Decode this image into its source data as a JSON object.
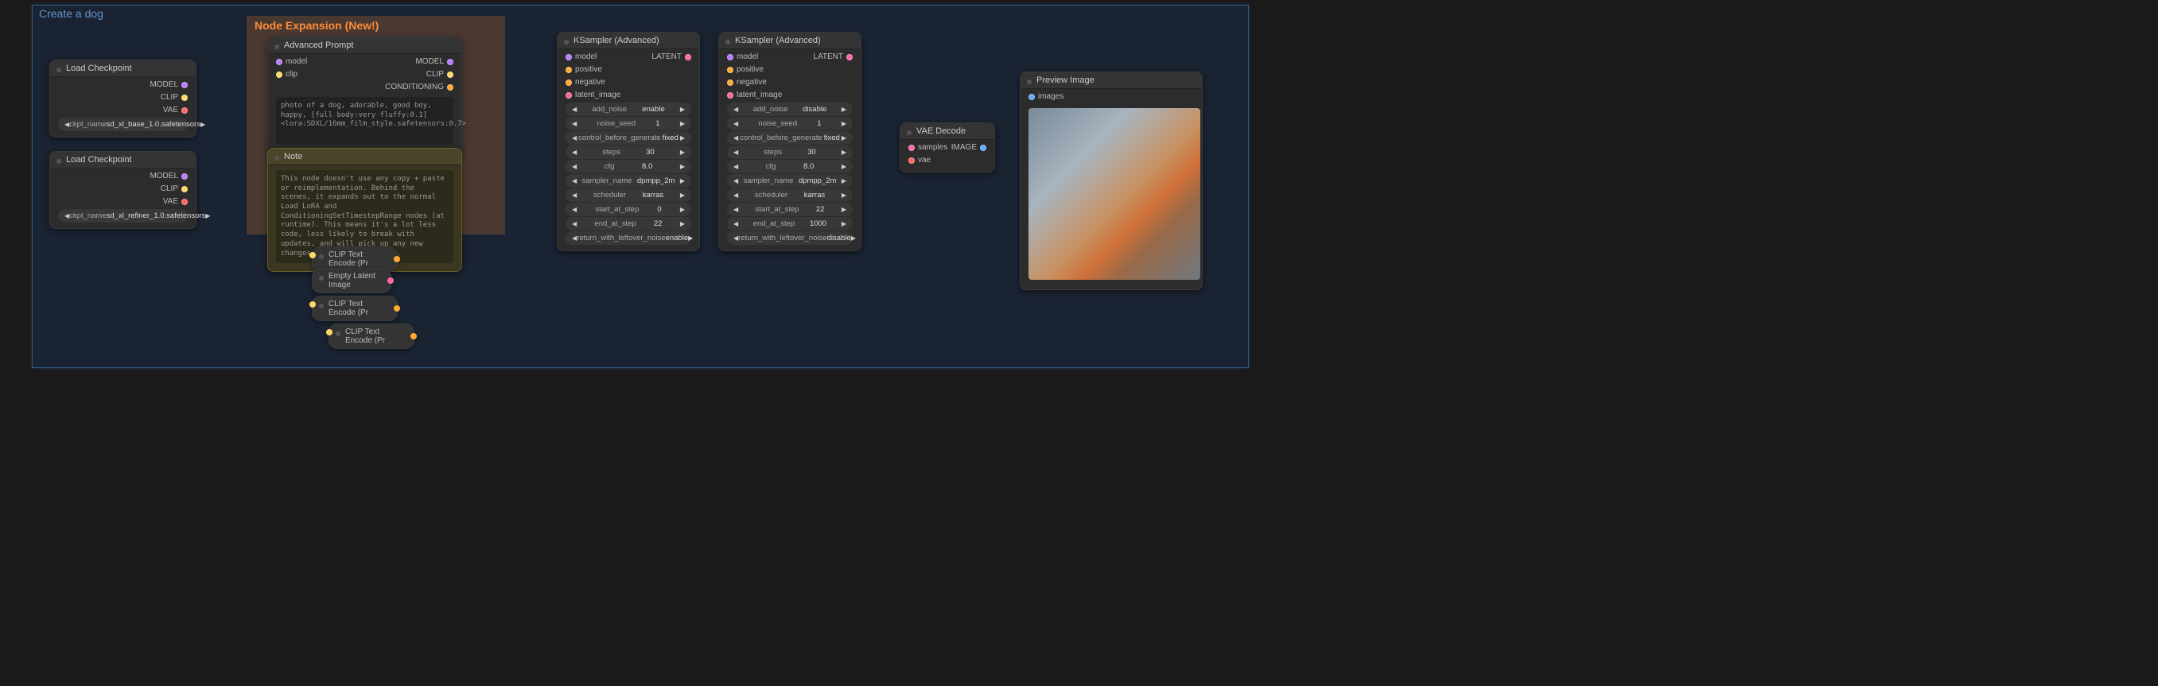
{
  "canvas_title": "Create a dog",
  "group_title": "Node Expansion (New!)",
  "load_ckpt": {
    "title": "Load Checkpoint",
    "widget": "ckpt_name",
    "value": "sd_xl_base_1.0.safetensors",
    "outs": [
      "MODEL",
      "CLIP",
      "VAE"
    ]
  },
  "load_ckpt2": {
    "title": "Load Checkpoint",
    "widget": "ckpt_name",
    "value": "sd_xl_refiner_1.0.safetensors",
    "outs": [
      "MODEL",
      "CLIP",
      "VAE"
    ]
  },
  "adv_prompt": {
    "title": "Advanced Prompt",
    "ins": [
      "model",
      "clip"
    ],
    "outs": [
      "MODEL",
      "CLIP",
      "CONDITIONING"
    ],
    "text": "photo of a dog, adorable, good boy, happy, [full body:very fluffy:0.1] <lora:SDXL/16mm_film_style.safetensors:0.7>"
  },
  "note": {
    "title": "Note",
    "text": "This node doesn't use any copy + paste or reimplementation. Behind the scenes, it expands out to the normal Load LoRA and ConditioningSetTimestepRange nodes (at runtime). This means it's a lot less code, less likely to break with updates, and will pick up any new changes made to those nodes."
  },
  "ksampler": {
    "title": "KSampler (Advanced)",
    "ins": [
      "model",
      "positive",
      "negative",
      "latent_image"
    ],
    "outs": [
      "LATENT"
    ],
    "widgets": [
      {
        "l": "add_noise",
        "v": "enable"
      },
      {
        "l": "noise_seed",
        "v": "1"
      },
      {
        "l": "control_before_generate",
        "v": "fixed"
      },
      {
        "l": "steps",
        "v": "30"
      },
      {
        "l": "cfg",
        "v": "8.0"
      },
      {
        "l": "sampler_name",
        "v": "dpmpp_2m"
      },
      {
        "l": "scheduler",
        "v": "karras"
      },
      {
        "l": "start_at_step",
        "v": "0"
      },
      {
        "l": "end_at_step",
        "v": "22"
      },
      {
        "l": "return_with_leftover_noise",
        "v": "enable"
      }
    ]
  },
  "ksampler2": {
    "title": "KSampler (Advanced)",
    "ins": [
      "model",
      "positive",
      "negative",
      "latent_image"
    ],
    "outs": [
      "LATENT"
    ],
    "widgets": [
      {
        "l": "add_noise",
        "v": "disable"
      },
      {
        "l": "noise_seed",
        "v": "1"
      },
      {
        "l": "control_before_generate",
        "v": "fixed"
      },
      {
        "l": "steps",
        "v": "30"
      },
      {
        "l": "cfg",
        "v": "8.0"
      },
      {
        "l": "sampler_name",
        "v": "dpmpp_2m"
      },
      {
        "l": "scheduler",
        "v": "karras"
      },
      {
        "l": "start_at_step",
        "v": "22"
      },
      {
        "l": "end_at_step",
        "v": "1000"
      },
      {
        "l": "return_with_leftover_noise",
        "v": "disable"
      }
    ]
  },
  "vae_decode": {
    "title": "VAE Decode",
    "ins": [
      "samples",
      "vae"
    ],
    "outs": [
      "IMAGE"
    ]
  },
  "preview": {
    "title": "Preview Image",
    "ins": [
      "images"
    ]
  },
  "mini": {
    "clip1": "CLIP Text Encode (Pr",
    "empty": "Empty Latent Image",
    "clip2": "CLIP Text Encode (Pr",
    "clip3": "CLIP Text Encode (Pr"
  }
}
